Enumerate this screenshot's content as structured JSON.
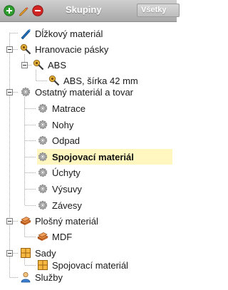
{
  "toolbar": {
    "title": "Skupiny",
    "filter_label": "Všetky",
    "buttons": [
      {
        "name": "add-icon",
        "color": "#2e9e2e"
      },
      {
        "name": "edit-icon",
        "color": "#e08a1e"
      },
      {
        "name": "delete-icon",
        "color": "#d42525"
      }
    ]
  },
  "tree": {
    "items": [
      {
        "label": "Dĺžkový materiál",
        "icon": "ruler-icon"
      },
      {
        "label": "Hranovacie pásky",
        "icon": "tape-key-icon"
      },
      {
        "label": "ABS",
        "icon": "tape-key-icon"
      },
      {
        "label": "ABS, šírka 42 mm",
        "icon": "tape-key-icon"
      },
      {
        "label": "Ostatný materiál a tovar",
        "icon": "gear-icon"
      },
      {
        "label": "Matrace",
        "icon": "gear-icon"
      },
      {
        "label": "Nohy",
        "icon": "gear-icon"
      },
      {
        "label": "Odpad",
        "icon": "gear-icon"
      },
      {
        "label": "Spojovací materiál",
        "icon": "gear-icon",
        "selected": true
      },
      {
        "label": "Úchyty",
        "icon": "gear-icon"
      },
      {
        "label": "Výsuvy",
        "icon": "gear-icon"
      },
      {
        "label": "Závesy",
        "icon": "gear-icon"
      },
      {
        "label": "Plošný materiál",
        "icon": "boards-icon"
      },
      {
        "label": "MDF",
        "icon": "boards-icon"
      },
      {
        "label": "Sady",
        "icon": "set-icon"
      },
      {
        "label": "Spojovací materiál",
        "icon": "set-icon"
      },
      {
        "label": "Služby",
        "icon": "person-icon"
      }
    ]
  },
  "colors": {
    "selected_background": "#fff7bf",
    "toolbar_gradient_top": "#cfcfcf",
    "toolbar_gradient_bottom": "#a9a9a9"
  }
}
